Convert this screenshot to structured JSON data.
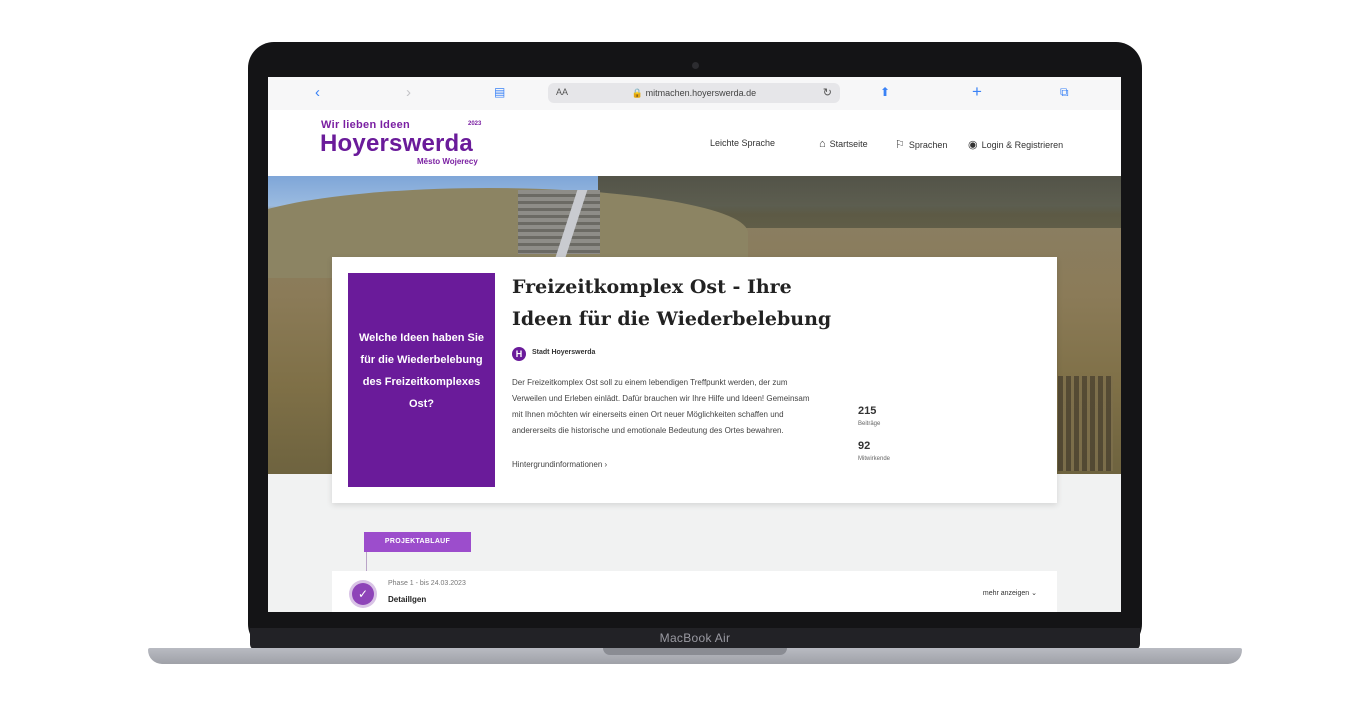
{
  "device": {
    "label": "MacBook Air"
  },
  "browser": {
    "text_size_label": "AA",
    "url": "mitmachen.hoyerswerda.de",
    "icons": {
      "back": "chevron-left-icon",
      "forward": "chevron-right-icon",
      "bookmarks": "book-icon",
      "reload": "reload-icon",
      "share": "share-icon",
      "new_tab": "plus-icon",
      "tabs": "tabs-icon",
      "lock": "lock-icon"
    }
  },
  "site": {
    "logo": {
      "tagline": "Wir lieben Ideen",
      "year": "2023",
      "name": "Hoyerswerda",
      "subtitle": "Město Wojerecy"
    },
    "nav": [
      {
        "label": "Leichte Sprache",
        "icon": ""
      },
      {
        "label": "Startseite",
        "icon": "home-icon"
      },
      {
        "label": "Sprachen",
        "icon": "flag-icon"
      },
      {
        "label": "Login & Registrieren",
        "icon": "user-circle-icon"
      }
    ]
  },
  "project": {
    "question": "Welche Ideen haben Sie für die Wiederbelebung des Freizeitkomplexes Ost?",
    "title": "Freizeitkomplex Ost - Ihre Ideen für die Wiederbelebung",
    "organization": "Stadt Hoyerswerda",
    "organization_initial": "H",
    "description": "Der Freizeitkomplex Ost soll zu einem lebendigen Treffpunkt werden, der zum Verweilen und Erleben einlädt. Dafür brauchen wir Ihre Hilfe und Ideen! Gemeinsam mit Ihnen möchten wir einerseits einen Ort neuer Möglichkeiten schaffen und andererseits die historische und emotionale Bedeutung des Ortes bewahren.",
    "more_link": "Hintergrundinformationen ›",
    "stats": [
      {
        "value": "215",
        "label": "Beiträge"
      },
      {
        "value": "92",
        "label": "Mitwirkende"
      }
    ]
  },
  "timeline": {
    "tag": "PROJEKTABLAUF",
    "phase": {
      "date": "Phase 1 - bis 24.03.2023",
      "name": "Detaillgen",
      "more": "mehr anzeigen"
    }
  }
}
